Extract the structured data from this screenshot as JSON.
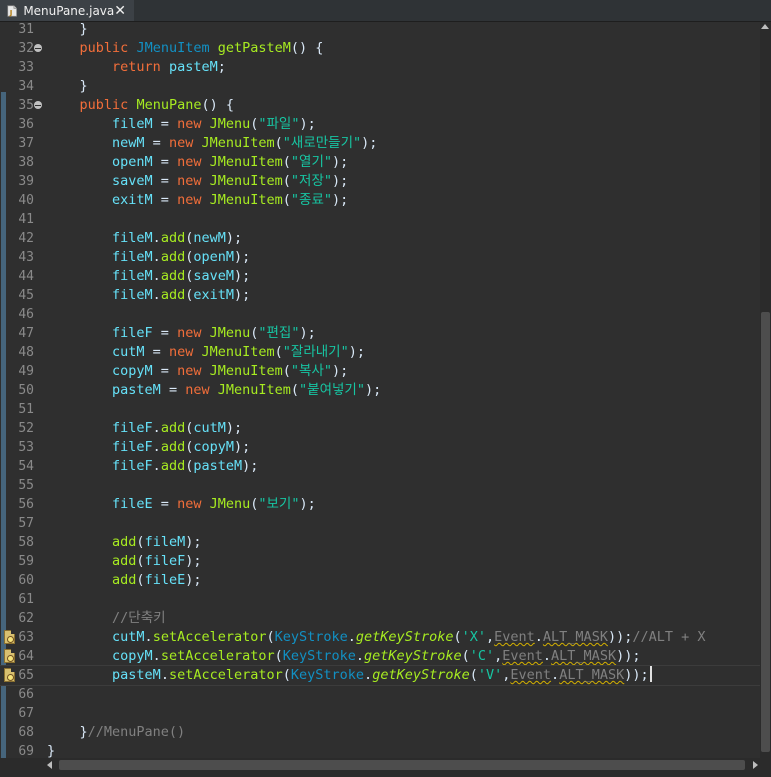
{
  "tab": {
    "filename": "MenuPane.java",
    "close": "✕",
    "icon": "java-file-icon"
  },
  "colors": {
    "keyword": "#f26e3a",
    "type": "#1290c3",
    "field": "#66e1f8",
    "method": "#a7ec21",
    "string": "#17c6a3",
    "comment": "#808080",
    "text": "#d9e8f7"
  },
  "lines": [
    {
      "n": "31",
      "tokens": [
        [
          "p",
          "    }"
        ]
      ]
    },
    {
      "n": "32",
      "fold": true,
      "tokens": [
        [
          "p",
          "    "
        ],
        [
          "k",
          "public"
        ],
        [
          "p",
          " "
        ],
        [
          "t",
          "JMenuItem"
        ],
        [
          "p",
          " "
        ],
        [
          "f",
          "getPasteM"
        ],
        [
          "p",
          "() {"
        ]
      ]
    },
    {
      "n": "33",
      "tokens": [
        [
          "p",
          "        "
        ],
        [
          "k",
          "return"
        ],
        [
          "p",
          " "
        ],
        [
          "v",
          "pasteM"
        ],
        [
          "p",
          ";"
        ]
      ]
    },
    {
      "n": "34",
      "tokens": [
        [
          "p",
          "    }"
        ]
      ]
    },
    {
      "n": "35",
      "fold": true,
      "tokens": [
        [
          "p",
          "    "
        ],
        [
          "k",
          "public"
        ],
        [
          "p",
          " "
        ],
        [
          "f",
          "MenuPane"
        ],
        [
          "p",
          "() {"
        ]
      ]
    },
    {
      "n": "36",
      "tokens": [
        [
          "p",
          "        "
        ],
        [
          "v",
          "fileM"
        ],
        [
          "p",
          " = "
        ],
        [
          "k",
          "new"
        ],
        [
          "p",
          " "
        ],
        [
          "f",
          "JMenu"
        ],
        [
          "p",
          "("
        ],
        [
          "s",
          "\"파일\""
        ],
        [
          "p",
          ");"
        ]
      ]
    },
    {
      "n": "37",
      "tokens": [
        [
          "p",
          "        "
        ],
        [
          "v",
          "newM"
        ],
        [
          "p",
          " = "
        ],
        [
          "k",
          "new"
        ],
        [
          "p",
          " "
        ],
        [
          "f",
          "JMenuItem"
        ],
        [
          "p",
          "("
        ],
        [
          "s",
          "\"새로만들기\""
        ],
        [
          "p",
          ");"
        ]
      ]
    },
    {
      "n": "38",
      "tokens": [
        [
          "p",
          "        "
        ],
        [
          "v",
          "openM"
        ],
        [
          "p",
          " = "
        ],
        [
          "k",
          "new"
        ],
        [
          "p",
          " "
        ],
        [
          "f",
          "JMenuItem"
        ],
        [
          "p",
          "("
        ],
        [
          "s",
          "\"열기\""
        ],
        [
          "p",
          ");"
        ]
      ]
    },
    {
      "n": "39",
      "tokens": [
        [
          "p",
          "        "
        ],
        [
          "v",
          "saveM"
        ],
        [
          "p",
          " = "
        ],
        [
          "k",
          "new"
        ],
        [
          "p",
          " "
        ],
        [
          "f",
          "JMenuItem"
        ],
        [
          "p",
          "("
        ],
        [
          "s",
          "\"저장\""
        ],
        [
          "p",
          ");"
        ]
      ]
    },
    {
      "n": "40",
      "tokens": [
        [
          "p",
          "        "
        ],
        [
          "v",
          "exitM"
        ],
        [
          "p",
          " = "
        ],
        [
          "k",
          "new"
        ],
        [
          "p",
          " "
        ],
        [
          "f",
          "JMenuItem"
        ],
        [
          "p",
          "("
        ],
        [
          "s",
          "\"종료\""
        ],
        [
          "p",
          ");"
        ]
      ]
    },
    {
      "n": "41",
      "tokens": []
    },
    {
      "n": "42",
      "tokens": [
        [
          "p",
          "        "
        ],
        [
          "v",
          "fileM"
        ],
        [
          "p",
          "."
        ],
        [
          "f",
          "add"
        ],
        [
          "p",
          "("
        ],
        [
          "v",
          "newM"
        ],
        [
          "p",
          ");"
        ]
      ]
    },
    {
      "n": "43",
      "tokens": [
        [
          "p",
          "        "
        ],
        [
          "v",
          "fileM"
        ],
        [
          "p",
          "."
        ],
        [
          "f",
          "add"
        ],
        [
          "p",
          "("
        ],
        [
          "v",
          "openM"
        ],
        [
          "p",
          ");"
        ]
      ]
    },
    {
      "n": "44",
      "tokens": [
        [
          "p",
          "        "
        ],
        [
          "v",
          "fileM"
        ],
        [
          "p",
          "."
        ],
        [
          "f",
          "add"
        ],
        [
          "p",
          "("
        ],
        [
          "v",
          "saveM"
        ],
        [
          "p",
          ");"
        ]
      ]
    },
    {
      "n": "45",
      "tokens": [
        [
          "p",
          "        "
        ],
        [
          "v",
          "fileM"
        ],
        [
          "p",
          "."
        ],
        [
          "f",
          "add"
        ],
        [
          "p",
          "("
        ],
        [
          "v",
          "exitM"
        ],
        [
          "p",
          ");"
        ]
      ]
    },
    {
      "n": "46",
      "tokens": []
    },
    {
      "n": "47",
      "tokens": [
        [
          "p",
          "        "
        ],
        [
          "v",
          "fileF"
        ],
        [
          "p",
          " = "
        ],
        [
          "k",
          "new"
        ],
        [
          "p",
          " "
        ],
        [
          "f",
          "JMenu"
        ],
        [
          "p",
          "("
        ],
        [
          "s",
          "\"편집\""
        ],
        [
          "p",
          ");"
        ]
      ]
    },
    {
      "n": "48",
      "tokens": [
        [
          "p",
          "        "
        ],
        [
          "v",
          "cutM"
        ],
        [
          "p",
          " = "
        ],
        [
          "k",
          "new"
        ],
        [
          "p",
          " "
        ],
        [
          "f",
          "JMenuItem"
        ],
        [
          "p",
          "("
        ],
        [
          "s",
          "\"잘라내기\""
        ],
        [
          "p",
          ");"
        ]
      ]
    },
    {
      "n": "49",
      "tokens": [
        [
          "p",
          "        "
        ],
        [
          "v",
          "copyM"
        ],
        [
          "p",
          " = "
        ],
        [
          "k",
          "new"
        ],
        [
          "p",
          " "
        ],
        [
          "f",
          "JMenuItem"
        ],
        [
          "p",
          "("
        ],
        [
          "s",
          "\"복사\""
        ],
        [
          "p",
          ");"
        ]
      ]
    },
    {
      "n": "50",
      "tokens": [
        [
          "p",
          "        "
        ],
        [
          "v",
          "pasteM"
        ],
        [
          "p",
          " = "
        ],
        [
          "k",
          "new"
        ],
        [
          "p",
          " "
        ],
        [
          "f",
          "JMenuItem"
        ],
        [
          "p",
          "("
        ],
        [
          "s",
          "\"붙여넣기\""
        ],
        [
          "p",
          ");"
        ]
      ]
    },
    {
      "n": "51",
      "tokens": []
    },
    {
      "n": "52",
      "tokens": [
        [
          "p",
          "        "
        ],
        [
          "v",
          "fileF"
        ],
        [
          "p",
          "."
        ],
        [
          "f",
          "add"
        ],
        [
          "p",
          "("
        ],
        [
          "v",
          "cutM"
        ],
        [
          "p",
          ");"
        ]
      ]
    },
    {
      "n": "53",
      "tokens": [
        [
          "p",
          "        "
        ],
        [
          "v",
          "fileF"
        ],
        [
          "p",
          "."
        ],
        [
          "f",
          "add"
        ],
        [
          "p",
          "("
        ],
        [
          "v",
          "copyM"
        ],
        [
          "p",
          ");"
        ]
      ]
    },
    {
      "n": "54",
      "tokens": [
        [
          "p",
          "        "
        ],
        [
          "v",
          "fileF"
        ],
        [
          "p",
          "."
        ],
        [
          "f",
          "add"
        ],
        [
          "p",
          "("
        ],
        [
          "v",
          "pasteM"
        ],
        [
          "p",
          ");"
        ]
      ]
    },
    {
      "n": "55",
      "tokens": []
    },
    {
      "n": "56",
      "tokens": [
        [
          "p",
          "        "
        ],
        [
          "v",
          "fileE"
        ],
        [
          "p",
          " = "
        ],
        [
          "k",
          "new"
        ],
        [
          "p",
          " "
        ],
        [
          "f",
          "JMenu"
        ],
        [
          "p",
          "("
        ],
        [
          "s",
          "\"보기\""
        ],
        [
          "p",
          ");"
        ]
      ]
    },
    {
      "n": "57",
      "tokens": []
    },
    {
      "n": "58",
      "tokens": [
        [
          "p",
          "        "
        ],
        [
          "f",
          "add"
        ],
        [
          "p",
          "("
        ],
        [
          "v",
          "fileM"
        ],
        [
          "p",
          ");"
        ]
      ]
    },
    {
      "n": "59",
      "tokens": [
        [
          "p",
          "        "
        ],
        [
          "f",
          "add"
        ],
        [
          "p",
          "("
        ],
        [
          "v",
          "fileF"
        ],
        [
          "p",
          ");"
        ]
      ]
    },
    {
      "n": "60",
      "tokens": [
        [
          "p",
          "        "
        ],
        [
          "f",
          "add"
        ],
        [
          "p",
          "("
        ],
        [
          "v",
          "fileE"
        ],
        [
          "p",
          ");"
        ]
      ]
    },
    {
      "n": "61",
      "tokens": []
    },
    {
      "n": "62",
      "tokens": [
        [
          "p",
          "        "
        ],
        [
          "c",
          "//단축키"
        ]
      ]
    },
    {
      "n": "63",
      "warn": true,
      "tokens": [
        [
          "p",
          "        "
        ],
        [
          "v",
          "cutM"
        ],
        [
          "p",
          "."
        ],
        [
          "f",
          "setAccelerator"
        ],
        [
          "p",
          "("
        ],
        [
          "t",
          "KeyStroke"
        ],
        [
          "p",
          "."
        ],
        [
          "fi",
          "getKeyStroke"
        ],
        [
          "p",
          "("
        ],
        [
          "s",
          "'X'"
        ],
        [
          "p",
          ","
        ],
        [
          "dep",
          "Event"
        ],
        [
          "p",
          "."
        ],
        [
          "dep",
          "ALT_MASK"
        ],
        [
          "p",
          "));"
        ],
        [
          "c",
          "//ALT + X"
        ]
      ]
    },
    {
      "n": "64",
      "warn": true,
      "tokens": [
        [
          "p",
          "        "
        ],
        [
          "v",
          "copyM"
        ],
        [
          "p",
          "."
        ],
        [
          "f",
          "setAccelerator"
        ],
        [
          "p",
          "("
        ],
        [
          "t",
          "KeyStroke"
        ],
        [
          "p",
          "."
        ],
        [
          "fi",
          "getKeyStroke"
        ],
        [
          "p",
          "("
        ],
        [
          "s",
          "'C'"
        ],
        [
          "p",
          ","
        ],
        [
          "dep",
          "Event"
        ],
        [
          "p",
          "."
        ],
        [
          "dep",
          "ALT_MASK"
        ],
        [
          "p",
          "));"
        ]
      ]
    },
    {
      "n": "65",
      "warn": true,
      "current": true,
      "tokens": [
        [
          "p",
          "        "
        ],
        [
          "v",
          "pasteM"
        ],
        [
          "p",
          "."
        ],
        [
          "f",
          "setAccelerator"
        ],
        [
          "p",
          "("
        ],
        [
          "t",
          "KeyStroke"
        ],
        [
          "p",
          "."
        ],
        [
          "fi",
          "getKeyStroke"
        ],
        [
          "p",
          "("
        ],
        [
          "s",
          "'V'"
        ],
        [
          "p",
          ","
        ],
        [
          "dep",
          "Event"
        ],
        [
          "p",
          "."
        ],
        [
          "dep",
          "ALT_MASK"
        ],
        [
          "p",
          "));"
        ],
        [
          "caret",
          ""
        ]
      ]
    },
    {
      "n": "66",
      "tokens": []
    },
    {
      "n": "67",
      "tokens": []
    },
    {
      "n": "68",
      "tokens": [
        [
          "p",
          "    }"
        ],
        [
          "c",
          "//MenuPane()"
        ]
      ]
    },
    {
      "n": "69",
      "tokens": [
        [
          "p",
          "}"
        ]
      ]
    }
  ]
}
